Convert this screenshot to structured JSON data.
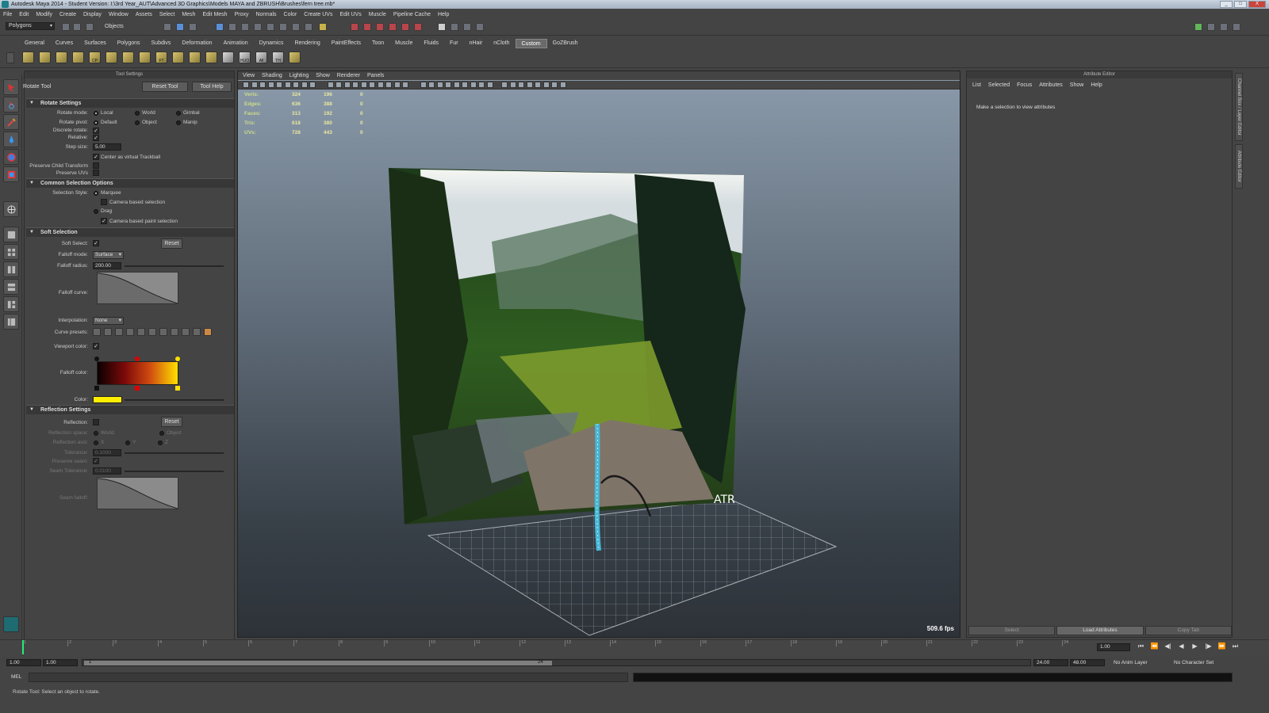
{
  "window": {
    "title": "Autodesk Maya 2014 - Student Version: I:\\3rd Year_AUT\\Advanced 3D Graphics\\Models MAYA and ZBRUSH\\Brushes\\fern tree.mb*",
    "controls": [
      "_",
      "□",
      "X"
    ]
  },
  "menubar": [
    "File",
    "Edit",
    "Modify",
    "Create",
    "Display",
    "Window",
    "Assets",
    "Select",
    "Mesh",
    "Edit Mesh",
    "Proxy",
    "Normals",
    "Color",
    "Create UVs",
    "Edit UVs",
    "Muscle",
    "Pipeline Cache",
    "Help"
  ],
  "statusline": {
    "mode": "Polygons",
    "selection_mode": "Objects"
  },
  "shelf": {
    "tabs": [
      "General",
      "Curves",
      "Surfaces",
      "Polygons",
      "Subdivs",
      "Deformation",
      "Animation",
      "Dynamics",
      "Rendering",
      "PaintEffects",
      "Toon",
      "Muscle",
      "Fluids",
      "Fur",
      "nHair",
      "nCloth",
      "Custom",
      "GoZBrush"
    ],
    "active": "Custom",
    "icon_labels": [
      "",
      "",
      "",
      "",
      "CP",
      "",
      "",
      "",
      "FT",
      "",
      "",
      "",
      "",
      "HUO",
      "All",
      "TH",
      ""
    ]
  },
  "tool_settings": {
    "panel_title": "Tool Settings",
    "tool_name": "Rotate Tool",
    "reset_btn": "Reset Tool",
    "help_btn": "Tool Help",
    "rotate": {
      "header": "Rotate Settings",
      "mode_label": "Rotate mode:",
      "mode_opts": [
        "Local",
        "World",
        "Gimbal"
      ],
      "pivot_label": "Rotate pivot:",
      "pivot_opts": [
        "Default",
        "Object",
        "Manip"
      ],
      "discrete_label": "Discrete rotate:",
      "relative_label": "Relative:",
      "step_label": "Step size:",
      "step_val": "5.00",
      "trackball_label": "Center as virtual Trackball",
      "child_label": "Preserve Child Transform",
      "uvs_label": "Preserve UVs"
    },
    "selection": {
      "header": "Common Selection Options",
      "style_label": "Selection Style:",
      "marquee": "Marquee",
      "camera_based": "Camera based selection",
      "drag": "Drag",
      "camera_paint": "Camera based paint selection"
    },
    "soft": {
      "header": "Soft Selection",
      "select_label": "Soft Select:",
      "reset": "Reset",
      "falloff_mode_label": "Falloff mode:",
      "falloff_mode": "Surface",
      "radius_label": "Falloff radius:",
      "radius_val": "200.00",
      "curve_label": "Falloff curve:",
      "interp_label": "Interpolation:",
      "interp_val": "None",
      "presets_label": "Curve presets:",
      "vpcolor_label": "Viewport color:",
      "falloff_color_label": "Falloff color:",
      "color_label": "Color:",
      "color_swatch": "#ffee00"
    },
    "reflection": {
      "header": "Reflection Settings",
      "refl_label": "Reflection:",
      "reset": "Reset",
      "space_label": "Reflection space:",
      "space_opts": [
        "World",
        "Object"
      ],
      "axis_label": "Reflection axis:",
      "axis_opts": [
        "X",
        "Y",
        "Z"
      ],
      "tol_label": "Tolerance:",
      "tol_val": "0.1000",
      "seam_label": "Preserve seam:",
      "seam_tol_label": "Seam Tolerance:",
      "seam_tol_val": "0.0100",
      "seam_falloff_label": "Seam falloff:"
    }
  },
  "viewport": {
    "menu": [
      "View",
      "Shading",
      "Lighting",
      "Show",
      "Renderer",
      "Panels"
    ],
    "hud": [
      {
        "label": "Verts:",
        "a": "324",
        "b": "196",
        "c": "0"
      },
      {
        "label": "Edges:",
        "a": "636",
        "b": "388",
        "c": "0"
      },
      {
        "label": "Faces:",
        "a": "313",
        "b": "192",
        "c": "0"
      },
      {
        "label": "Tris:",
        "a": "618",
        "b": "380",
        "c": "0"
      },
      {
        "label": "UVs:",
        "a": "728",
        "b": "443",
        "c": "0"
      }
    ],
    "fps": "509.6 fps",
    "image_caption": "ATR"
  },
  "attribute_editor": {
    "title": "Attribute Editor",
    "menu": [
      "List",
      "Selected",
      "Focus",
      "Attributes",
      "Show",
      "Help"
    ],
    "message": "Make a selection to view attributes",
    "buttons": [
      "Select",
      "Load Attributes",
      "Copy Tab"
    ],
    "side_tabs": [
      "Channel Box / Layer Editor",
      "Attribute Editor"
    ]
  },
  "timeline": {
    "ticks": [
      "1",
      "2",
      "3",
      "4",
      "5",
      "6",
      "7",
      "8",
      "9",
      "10",
      "11",
      "12",
      "13",
      "14",
      "15",
      "16",
      "17",
      "18",
      "19",
      "20",
      "21",
      "22",
      "23",
      "24"
    ],
    "current": "1.00",
    "range_start": "1.00",
    "range_start2": "1.00",
    "range_min": "1",
    "range_max": "24",
    "end": "24.00",
    "end2": "48.00",
    "anim_layer": "No Anim Layer",
    "char_set": "No Character Set",
    "playback": [
      "⏮",
      "⏪",
      "◀|",
      "◀",
      "▶",
      "|▶",
      "⏩",
      "⏭"
    ]
  },
  "commandline": {
    "label": "MEL"
  },
  "helpline": "Rotate Tool: Select an object to rotate."
}
